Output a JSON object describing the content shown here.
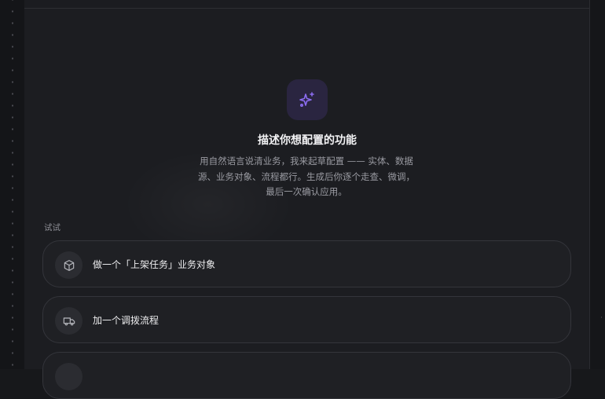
{
  "hero": {
    "icon": "sparkles-icon",
    "title": "描述你想配置的功能",
    "desc_line1": "用自然语言说清业务，我来起草配置 —— 实体、数据",
    "desc_line2": "源、业务对象、流程都行。生成后你逐个走查、微调，",
    "desc_line3": "最后一次确认应用。"
  },
  "suggestions": {
    "label": "试试",
    "items": [
      {
        "icon": "cube-icon",
        "label": "做一个「上架任务」业务对象"
      },
      {
        "icon": "truck-icon",
        "label": "加一个调拨流程"
      },
      {
        "icon": "circle-icon",
        "label": ""
      }
    ]
  },
  "colors": {
    "accent": "#8b6cf0",
    "background": "#17181b",
    "panel": "#1c1d21"
  }
}
